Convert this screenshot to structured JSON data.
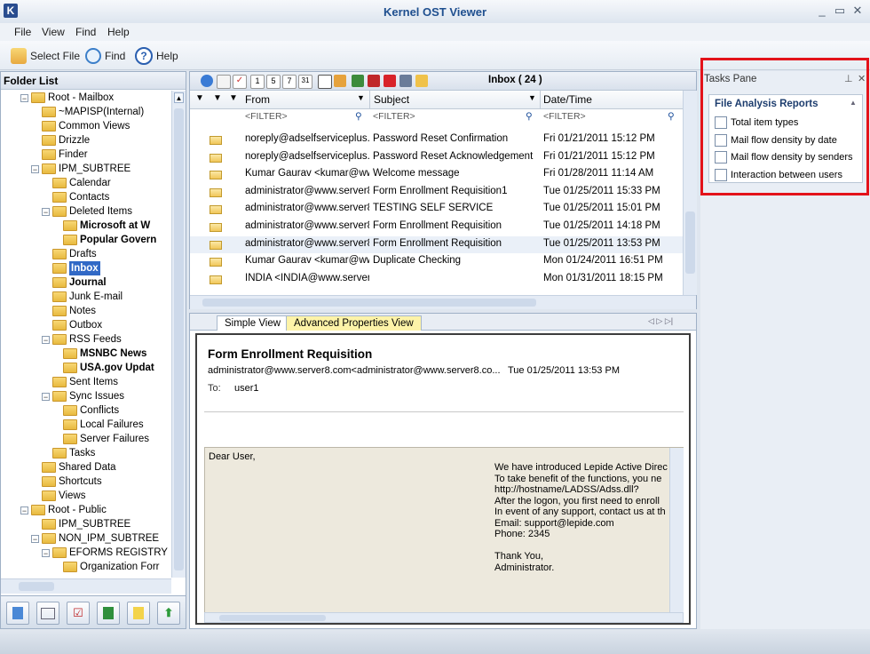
{
  "app": {
    "title": "Kernel OST Viewer",
    "icon_letter": "K"
  },
  "window_controls": [
    "_",
    "▭",
    "✕"
  ],
  "menu": [
    "File",
    "View",
    "Find",
    "Help"
  ],
  "toolbar": {
    "select_file": "Select File",
    "find": "Find",
    "help": "Help"
  },
  "folder_list": {
    "title": "Folder List",
    "items": [
      {
        "label": "Root - Mailbox",
        "indent": 0,
        "exp": "−"
      },
      {
        "label": "~MAPISP(Internal)",
        "indent": 2,
        "exp": ""
      },
      {
        "label": "Common Views",
        "indent": 2,
        "exp": ""
      },
      {
        "label": "Drizzle",
        "indent": 2,
        "exp": ""
      },
      {
        "label": "Finder",
        "indent": 2,
        "exp": ""
      },
      {
        "label": "IPM_SUBTREE",
        "indent": 1,
        "exp": "−"
      },
      {
        "label": "Calendar",
        "indent": 3,
        "exp": ""
      },
      {
        "label": "Contacts",
        "indent": 3,
        "exp": ""
      },
      {
        "label": "Deleted Items",
        "indent": 2,
        "exp": "−"
      },
      {
        "label": "Microsoft at W",
        "indent": 4,
        "exp": "",
        "bold": true
      },
      {
        "label": "Popular Govern",
        "indent": 4,
        "exp": "",
        "bold": true
      },
      {
        "label": "Drafts",
        "indent": 3,
        "exp": ""
      },
      {
        "label": "Inbox",
        "indent": 3,
        "exp": "",
        "bold": true,
        "selected": true
      },
      {
        "label": "Journal",
        "indent": 3,
        "exp": "",
        "bold": true
      },
      {
        "label": "Junk E-mail",
        "indent": 3,
        "exp": ""
      },
      {
        "label": "Notes",
        "indent": 3,
        "exp": ""
      },
      {
        "label": "Outbox",
        "indent": 3,
        "exp": ""
      },
      {
        "label": "RSS Feeds",
        "indent": 2,
        "exp": "−"
      },
      {
        "label": "MSNBC News",
        "indent": 4,
        "exp": "",
        "bold": true
      },
      {
        "label": "USA.gov Updat",
        "indent": 4,
        "exp": "",
        "bold": true
      },
      {
        "label": "Sent Items",
        "indent": 3,
        "exp": ""
      },
      {
        "label": "Sync Issues",
        "indent": 2,
        "exp": "−"
      },
      {
        "label": "Conflicts",
        "indent": 4,
        "exp": ""
      },
      {
        "label": "Local Failures",
        "indent": 4,
        "exp": ""
      },
      {
        "label": "Server Failures",
        "indent": 4,
        "exp": ""
      },
      {
        "label": "Tasks",
        "indent": 3,
        "exp": ""
      },
      {
        "label": "Shared Data",
        "indent": 2,
        "exp": ""
      },
      {
        "label": "Shortcuts",
        "indent": 2,
        "exp": ""
      },
      {
        "label": "Views",
        "indent": 2,
        "exp": ""
      },
      {
        "label": "Root - Public",
        "indent": 0,
        "exp": "−"
      },
      {
        "label": "IPM_SUBTREE",
        "indent": 2,
        "exp": ""
      },
      {
        "label": "NON_IPM_SUBTREE",
        "indent": 1,
        "exp": "−"
      },
      {
        "label": "EFORMS REGISTRY",
        "indent": 2,
        "exp": "−"
      },
      {
        "label": "Organization Forr",
        "indent": 4,
        "exp": ""
      }
    ]
  },
  "message_list": {
    "folder_label": "Inbox ( 24 )",
    "columns": {
      "from": "From",
      "subject": "Subject",
      "date": "Date/Time"
    },
    "filter_placeholder": "<FILTER>",
    "rows": [
      {
        "from": "noreply@adselfserviceplus....",
        "subject": "Password Reset Confirmation",
        "date": "Fri 01/21/2011 15:12 PM"
      },
      {
        "from": "noreply@adselfserviceplus....",
        "subject": "Password Reset Acknowledgement",
        "date": "Fri 01/21/2011 15:12 PM"
      },
      {
        "from": "Kumar Gaurav <kumar@www....",
        "subject": "Welcome message",
        "date": "Fri 01/28/2011 11:14 AM"
      },
      {
        "from": "administrator@www.server8....",
        "subject": "Form Enrollment Requisition1",
        "date": "Tue 01/25/2011 15:33 PM"
      },
      {
        "from": "administrator@www.server8....",
        "subject": "TESTING SELF SERVICE",
        "date": "Tue 01/25/2011 15:01 PM"
      },
      {
        "from": "administrator@www.server8....",
        "subject": "Form Enrollment Requisition",
        "date": "Tue 01/25/2011 14:18 PM"
      },
      {
        "from": "administrator@www.server8....",
        "subject": "Form Enrollment Requisition",
        "date": "Tue 01/25/2011 13:53 PM"
      },
      {
        "from": "Kumar Gaurav <kumar@www....",
        "subject": "Duplicate Checking",
        "date": "Mon 01/24/2011 16:51 PM"
      },
      {
        "from": "INDIA <INDIA@www.server....",
        "subject": "",
        "date": "Mon 01/31/2011 18:15 PM"
      }
    ]
  },
  "preview": {
    "tabs": [
      "Simple View",
      "Advanced Properties View"
    ],
    "subject": "Form Enrollment Requisition",
    "from_line": "administrator@www.server8.com<administrator@www.server8.co...",
    "date": "Tue 01/25/2011 13:53 PM",
    "to_label": "To:",
    "to_value": "user1",
    "body_greeting": "Dear User,",
    "body_lines": [
      "We have introduced Lepide Active Direc",
      "To take benefit of the functions, you ne",
      "http://hostname/LADSS/Adss.dll?",
      "After the logon, you first need to enroll",
      "In event of any support, contact us at th",
      "Email: support@lepide.com",
      "Phone: 2345",
      "",
      "Thank You,",
      "Administrator."
    ]
  },
  "tasks_pane": {
    "title": "Tasks Pane",
    "section_title": "File Analysis Reports",
    "items": [
      "Total item types",
      "Mail flow density by date",
      "Mail flow density by senders",
      "Interaction between users"
    ]
  },
  "colors": {
    "accent": "#1f4f8f",
    "highlight_box": "#e3121a",
    "selected_folder": "#3169c6",
    "tab_active": "#fdf3a8"
  }
}
